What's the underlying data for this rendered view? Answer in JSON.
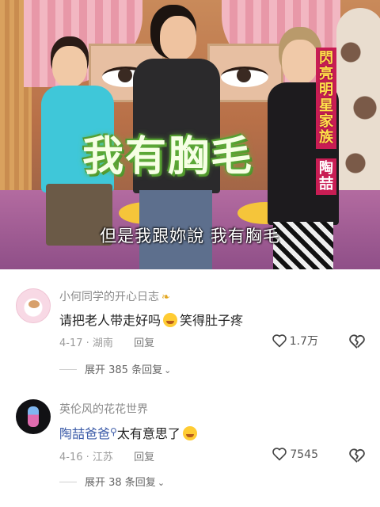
{
  "video": {
    "show_title": "閃亮明星家族",
    "host_name": "陶喆",
    "big_caption": "我有胸毛",
    "subtitle": "但是我跟妳說  我有胸毛"
  },
  "comments": [
    {
      "user": "小何同学的开心日志",
      "text_before": "请把老人带走好吗",
      "text_after": "笑得肚子疼",
      "date": "4-17",
      "location": "湖南",
      "reply_label": "回复",
      "likes": "1.7万",
      "expand_label": "展开 385 条回复"
    },
    {
      "user": "英伦风的花花世界",
      "mention": "陶喆爸爸",
      "text_after": "太有意思了",
      "date": "4-16",
      "location": "江苏",
      "reply_label": "回复",
      "likes": "7545",
      "expand_label": "展开 38 条回复"
    }
  ],
  "icons": {
    "like": "heart-outline-icon",
    "dislike": "broken-heart-icon",
    "expand": "chevron-down-icon",
    "badge": "leaf-badge-icon"
  }
}
